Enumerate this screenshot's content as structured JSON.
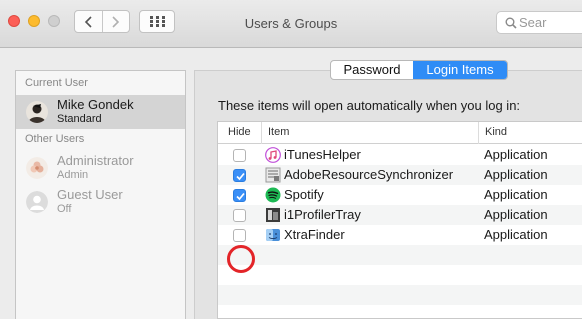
{
  "window": {
    "title": "Users & Groups"
  },
  "toolbar": {
    "search_placeholder": "Sear"
  },
  "sidebar": {
    "current_user_heading": "Current User",
    "other_users_heading": "Other Users",
    "current_user": {
      "name": "Mike Gondek",
      "role": "Standard"
    },
    "other_users": [
      {
        "name": "Administrator",
        "role": "Admin"
      },
      {
        "name": "Guest User",
        "role": "Off"
      }
    ]
  },
  "tabs": {
    "password": "Password",
    "login_items": "Login Items",
    "selected": "login_items"
  },
  "content": {
    "description": "These items will open automatically when you log in:",
    "columns": {
      "hide": "Hide",
      "item": "Item",
      "kind": "Kind"
    },
    "items": [
      {
        "name": "iTunesHelper",
        "kind": "Application",
        "hide": false,
        "icon": "itunes-icon"
      },
      {
        "name": "AdobeResourceSynchronizer",
        "kind": "Application",
        "hide": true,
        "icon": "adobe-sync-icon"
      },
      {
        "name": "Spotify",
        "kind": "Application",
        "hide": true,
        "icon": "spotify-icon"
      },
      {
        "name": "i1ProfilerTray",
        "kind": "Application",
        "hide": false,
        "icon": "i1profiler-icon"
      },
      {
        "name": "XtraFinder",
        "kind": "Application",
        "hide": false,
        "icon": "xtrafinder-icon"
      }
    ]
  },
  "colors": {
    "accent": "#2f8cf6",
    "highlight_circle": "#e32428"
  }
}
